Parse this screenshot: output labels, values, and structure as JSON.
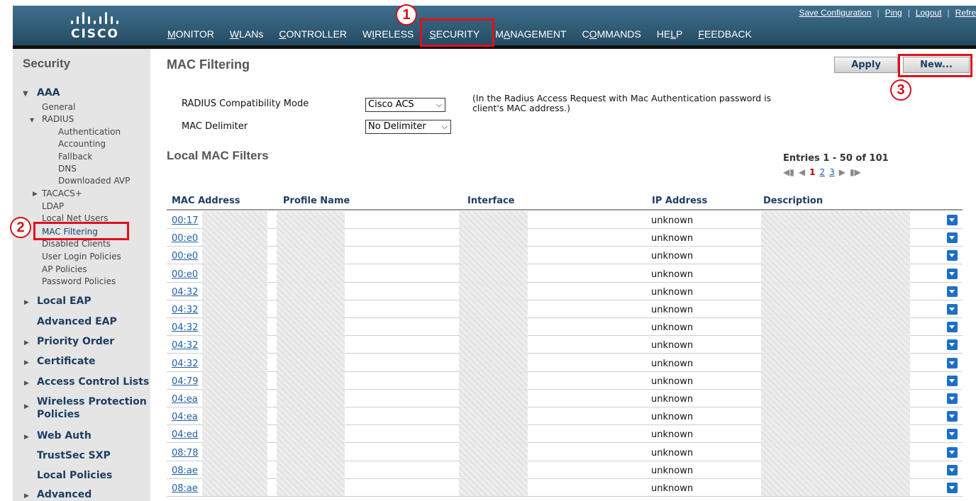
{
  "header": {
    "logo_text": "CISCO",
    "nav": [
      {
        "pre": "",
        "u": "M",
        "post": "ONITOR"
      },
      {
        "pre": "",
        "u": "W",
        "post": "LANs"
      },
      {
        "pre": "",
        "u": "C",
        "post": "ONTROLLER"
      },
      {
        "pre": "W",
        "u": "I",
        "post": "RELESS"
      },
      {
        "pre": "",
        "u": "S",
        "post": "ECURITY"
      },
      {
        "pre": "M",
        "u": "A",
        "post": "NAGEMENT"
      },
      {
        "pre": "C",
        "u": "O",
        "post": "MMANDS"
      },
      {
        "pre": "HE",
        "u": "L",
        "post": "P"
      },
      {
        "pre": "",
        "u": "F",
        "post": "EEDBACK"
      }
    ],
    "utility": {
      "save": "Save Configuration",
      "ping": "Ping",
      "logout": "Logout",
      "refresh": "Refre"
    }
  },
  "sidebar": {
    "title": "Security",
    "aaa": "AAA",
    "general": "General",
    "radius": "RADIUS",
    "radius_items": [
      "Authentication",
      "Accounting",
      "Fallback",
      "DNS",
      "Downloaded AVP"
    ],
    "tacacs": "TACACS+",
    "aaa_items": [
      "LDAP",
      "Local Net Users",
      "MAC Filtering",
      "Disabled Clients",
      "User Login Policies",
      "AP Policies",
      "Password Policies"
    ],
    "sections": [
      "Local EAP",
      "Advanced EAP",
      "Priority Order",
      "Certificate",
      "Access Control Lists",
      "Wireless Protection",
      "Policies",
      "Web Auth",
      "TrustSec SXP",
      "Local Policies",
      "Advanced"
    ]
  },
  "main": {
    "title": "MAC Filtering",
    "apply": "Apply",
    "new": "New...",
    "radius_mode_label": "RADIUS Compatibility Mode",
    "radius_mode_value": "Cisco ACS",
    "mac_delim_label": "MAC Delimiter",
    "mac_delim_value": "No Delimiter",
    "note": "(In the Radius Access Request with Mac Authentication password is client's MAC address.)",
    "section_title": "Local MAC Filters",
    "entries": "Entries 1 - 50 of 101",
    "pages": [
      "1",
      "2",
      "3"
    ],
    "columns": [
      "MAC Address",
      "Profile Name",
      "Interface",
      "IP Address",
      "Description"
    ],
    "rows": [
      {
        "mac": "00:17",
        "ip": "unknown"
      },
      {
        "mac": "00:e0",
        "ip": "unknown"
      },
      {
        "mac": "00:e0",
        "ip": "unknown"
      },
      {
        "mac": "00:e0",
        "ip": "unknown"
      },
      {
        "mac": "04:32",
        "ip": "unknown"
      },
      {
        "mac": "04:32",
        "ip": "unknown"
      },
      {
        "mac": "04:32",
        "ip": "unknown"
      },
      {
        "mac": "04:32",
        "ip": "unknown"
      },
      {
        "mac": "04:32",
        "ip": "unknown"
      },
      {
        "mac": "04:79",
        "ip": "unknown"
      },
      {
        "mac": "04:ea",
        "ip": "unknown"
      },
      {
        "mac": "04:ea",
        "ip": "unknown"
      },
      {
        "mac": "04:ed",
        "ip": "unknown"
      },
      {
        "mac": "08:78",
        "ip": "unknown"
      },
      {
        "mac": "08:ae",
        "ip": "unknown"
      },
      {
        "mac": "08:ae",
        "ip": "unknown"
      }
    ]
  },
  "annotations": [
    "1",
    "2",
    "3"
  ],
  "colors": {
    "header": "#2d5670",
    "highlight": "#e0101a",
    "link": "#1f5fa8",
    "sidebar": "#e5e5e5"
  }
}
